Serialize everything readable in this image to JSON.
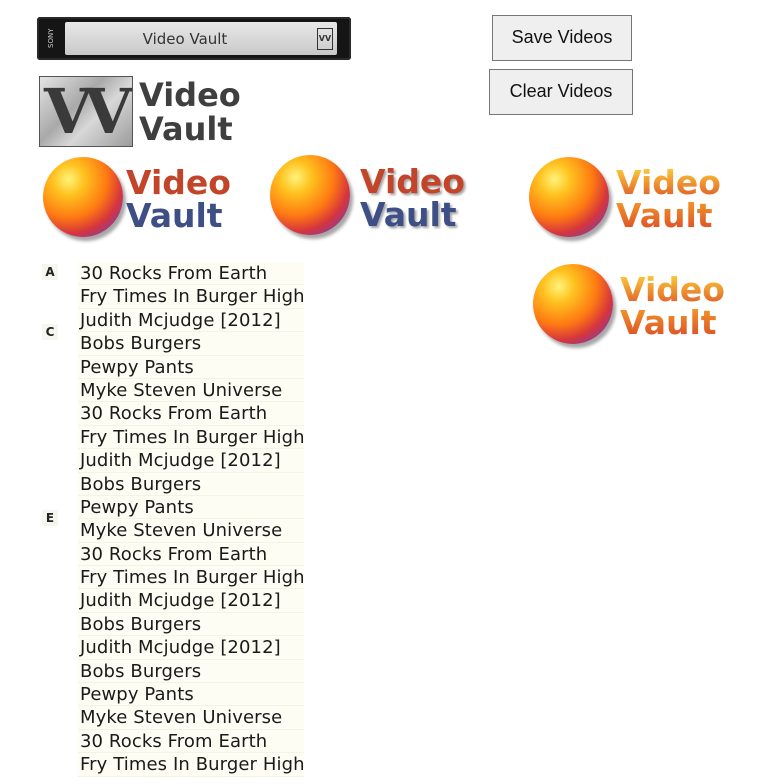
{
  "vhs_logo": {
    "brand": "SONY",
    "label": "Video Vault",
    "mini": "VV"
  },
  "buttons": {
    "save_label": "Save Videos",
    "clear_label": "Clear Videos"
  },
  "vv_logo": {
    "mark": "VV",
    "word1": "Video",
    "word2": "Vault"
  },
  "sphere_logos": [
    {
      "word1": "Video",
      "word2": "Vault",
      "colors": {
        "word1": "#c2452a",
        "word2": "#3e4f86"
      }
    },
    {
      "word1": "Video",
      "word2": "Vault",
      "colors": {
        "word1": "#c2452a",
        "word2": "#3e4f86"
      }
    },
    {
      "word1": "Video",
      "word2": "Vault",
      "colors": {
        "word1": "#f2a22a",
        "word2": "#e0622a"
      }
    },
    {
      "word1": "Video",
      "word2": "Vault",
      "colors": {
        "word1": "#f2a22a",
        "word2": "#e0622a"
      }
    }
  ],
  "index_letters": [
    "A",
    "C",
    "E"
  ],
  "videos": [
    "30 Rocks From Earth",
    "Fry Times In Burger High",
    "Judith Mcjudge [2012]",
    "Bobs Burgers",
    "Pewpy Pants",
    "Myke Steven Universe",
    "30 Rocks From Earth",
    "Fry Times In Burger High",
    "Judith Mcjudge [2012]",
    "Bobs Burgers",
    "Pewpy Pants",
    "Myke Steven Universe",
    "30 Rocks From Earth",
    "Fry Times In Burger High",
    "Judith Mcjudge [2012]",
    "Bobs Burgers",
    "Judith Mcjudge [2012]",
    "Bobs Burgers",
    "Pewpy Pants",
    "Myke Steven Universe",
    "30 Rocks From Earth",
    "Fry Times In Burger High"
  ]
}
